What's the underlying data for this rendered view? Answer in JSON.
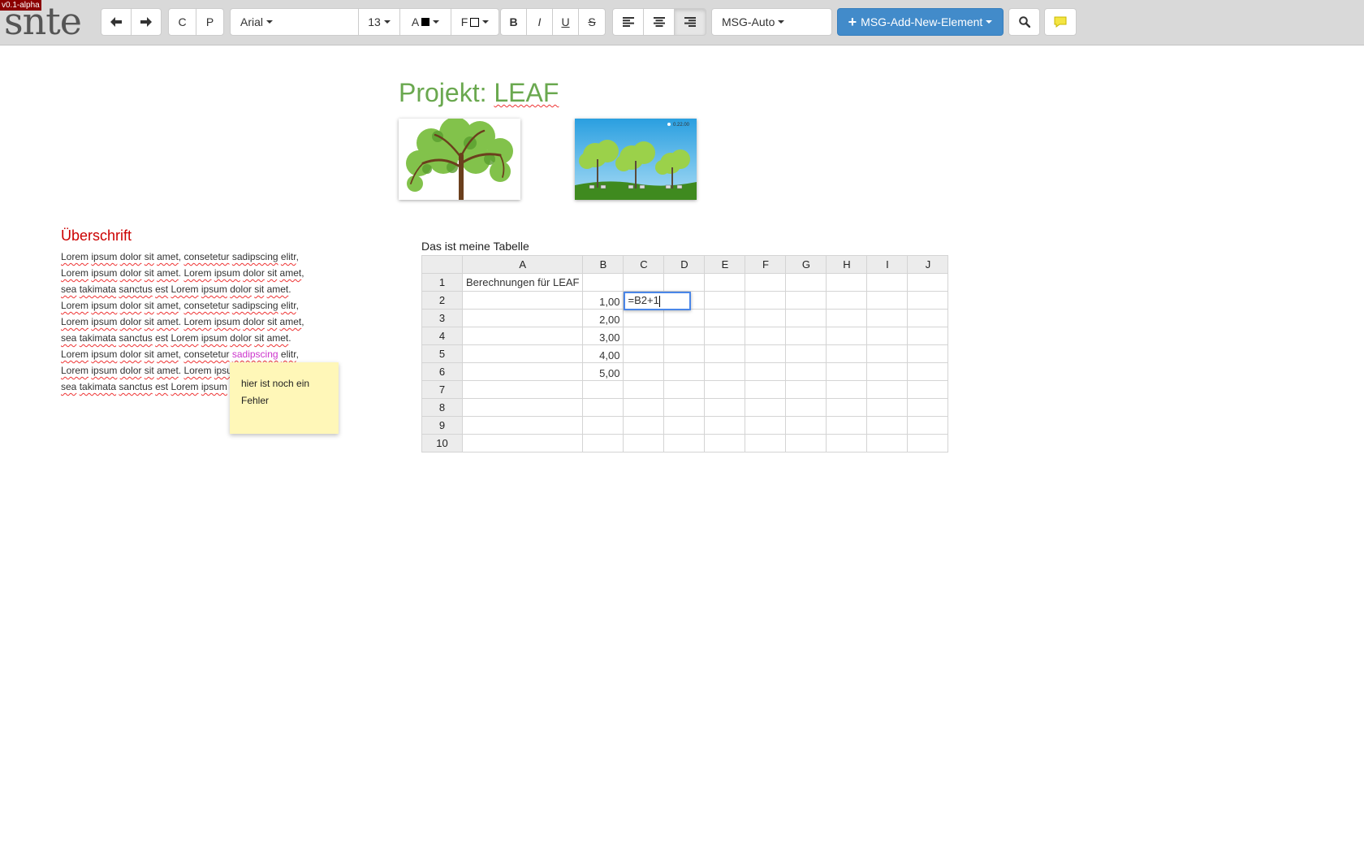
{
  "app": {
    "logo": "snte",
    "version": "v0.1-alpha"
  },
  "toolbar": {
    "back_icon": "arrow-left-icon",
    "forward_icon": "arrow-right-icon",
    "copy_label": "C",
    "paste_label": "P",
    "font_family": "Arial",
    "font_size": "13",
    "text_color_label": "A",
    "fill_color_label": "F",
    "bold_label": "B",
    "italic_label": "I",
    "underline_label": "U",
    "strike_label": "S",
    "style_select": "MSG-Auto",
    "add_element_label": "MSG-Add-New-Element",
    "search_icon": "search-icon",
    "comment_icon": "comment-icon",
    "accent_color": "#428bca",
    "comment_color": "#f4e542"
  },
  "document": {
    "title_prefix": "Projekt: ",
    "title_name": "LEAF",
    "title_color": "#6aa84f",
    "images": [
      {
        "name": "tree-image"
      },
      {
        "name": "landscape-image",
        "overlay_text": "0.22.00"
      }
    ],
    "heading": "Überschrift",
    "heading_color": "#cc0000",
    "note": "hier ist noch ein Fehler",
    "table_caption": "Das ist meine Tabelle"
  },
  "sheet": {
    "columns": [
      "A",
      "B",
      "C",
      "D",
      "E",
      "F",
      "G",
      "H",
      "I",
      "J"
    ],
    "rows": [
      {
        "n": "1",
        "A": "Berechnungen für LEAF",
        "B": ""
      },
      {
        "n": "2",
        "A": "",
        "B": "1,00"
      },
      {
        "n": "3",
        "A": "",
        "B": "2,00"
      },
      {
        "n": "4",
        "A": "",
        "B": "3,00"
      },
      {
        "n": "5",
        "A": "",
        "B": "4,00"
      },
      {
        "n": "6",
        "A": "",
        "B": "5,00"
      },
      {
        "n": "7",
        "A": "",
        "B": ""
      },
      {
        "n": "8",
        "A": "",
        "B": ""
      },
      {
        "n": "9",
        "A": "",
        "B": ""
      },
      {
        "n": "10",
        "A": "",
        "B": ""
      }
    ],
    "active_cell": "C2",
    "editor_value": "=B2+1"
  }
}
